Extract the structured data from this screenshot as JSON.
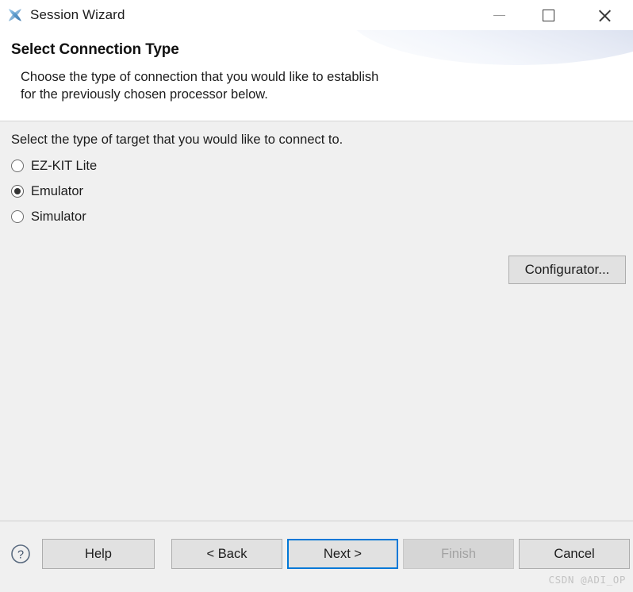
{
  "window": {
    "title": "Session Wizard",
    "icon": "session-wizard-icon",
    "controls": {
      "minimize": "minimize-icon",
      "maximize": "maximize-icon",
      "close": "close-icon"
    }
  },
  "header": {
    "title": "Select Connection Type",
    "description_line1": "Choose the type of connection that you would like to establish",
    "description_line2": "for the previously chosen processor below."
  },
  "body": {
    "prompt": "Select the type of target that you would like to connect to.",
    "radios": [
      {
        "label": "EZ-KIT Lite",
        "checked": false
      },
      {
        "label": "Emulator",
        "checked": true
      },
      {
        "label": "Simulator",
        "checked": false
      }
    ],
    "configurator_button": "Configurator..."
  },
  "footer": {
    "help_icon": "help-circle-icon",
    "buttons": [
      {
        "label": "Help",
        "state": "enabled"
      },
      {
        "label": "< Back",
        "state": "enabled"
      },
      {
        "label": "Next >",
        "state": "focused"
      },
      {
        "label": "Finish",
        "state": "disabled"
      },
      {
        "label": "Cancel",
        "state": "enabled"
      }
    ],
    "watermark": "CSDN @ADI_OP"
  },
  "colors": {
    "accent_focus": "#0078d7",
    "body_background": "#f0f0f0",
    "header_background": "#ffffff",
    "button_face": "#e1e1e1",
    "disabled_text": "#a2a2a2",
    "icon_blue": "#5b9bd5",
    "watermark_text": "#c3c3c3"
  }
}
